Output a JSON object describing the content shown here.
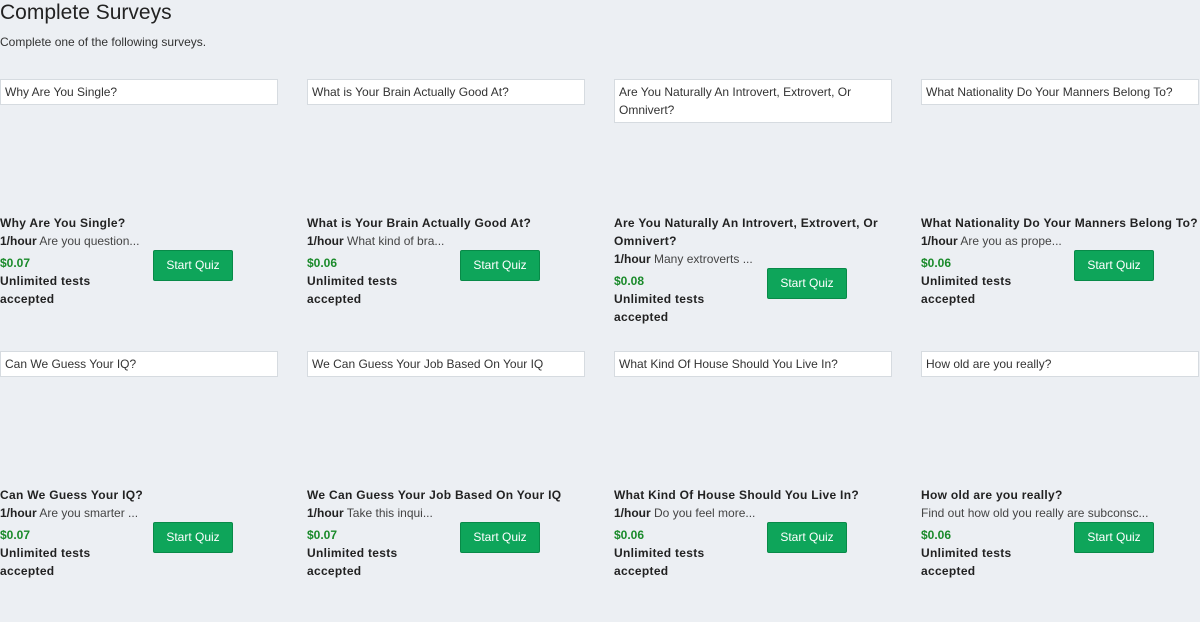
{
  "page": {
    "title": "Complete Surveys",
    "subtitle": "Complete one of the following surveys."
  },
  "surveys": [
    {
      "thumb": "Why Are You Single?",
      "title": "Why Are You Single?",
      "rate": "1/hour",
      "desc": "Are you question...",
      "price": "$0.07",
      "tests": "Unlimited tests accepted",
      "button": "Start Quiz"
    },
    {
      "thumb": "What is Your Brain Actually Good At?",
      "title": "What is Your Brain Actually Good At?",
      "rate": "1/hour",
      "desc": "What kind of bra...",
      "price": "$0.06",
      "tests": "Unlimited tests accepted",
      "button": "Start Quiz"
    },
    {
      "thumb": "Are You Naturally An Introvert, Extrovert, Or Omnivert?",
      "title": "Are You Naturally An Introvert, Extrovert, Or Omnivert?",
      "rate": "1/hour",
      "desc": "Many extroverts ...",
      "price": "$0.08",
      "tests": "Unlimited tests accepted",
      "button": "Start Quiz"
    },
    {
      "thumb": "What Nationality Do Your Manners Belong To?",
      "title": "What Nationality Do Your Manners Belong To?",
      "rate": "1/hour",
      "desc": "Are you as prope...",
      "price": "$0.06",
      "tests": "Unlimited tests accepted",
      "button": "Start Quiz"
    },
    {
      "thumb": "Can We Guess Your IQ?",
      "title": "Can We Guess Your IQ?",
      "rate": "1/hour",
      "desc": "Are you smarter ...",
      "price": "$0.07",
      "tests": "Unlimited tests accepted",
      "button": "Start Quiz"
    },
    {
      "thumb": "We Can Guess Your Job Based On Your IQ",
      "title": "We Can Guess Your Job Based On Your IQ",
      "rate": "1/hour",
      "desc": "Take this inqui...",
      "price": "$0.07",
      "tests": "Unlimited tests accepted",
      "button": "Start Quiz"
    },
    {
      "thumb": "What Kind Of House Should You Live In?",
      "title": "What Kind Of House Should You Live In?",
      "rate": "1/hour",
      "desc": "Do you feel more...",
      "price": "$0.06",
      "tests": "Unlimited tests accepted",
      "button": "Start Quiz"
    },
    {
      "thumb": "How old are you really?",
      "title": "How old are you really?",
      "rate": "",
      "desc": "Find out how old you really are subconsc...",
      "price": "$0.06",
      "tests": "Unlimited tests accepted",
      "button": "Start Quiz"
    }
  ],
  "colors": {
    "price": "#1a8a2a",
    "button": "#0ea55a",
    "background": "#eceff3"
  }
}
